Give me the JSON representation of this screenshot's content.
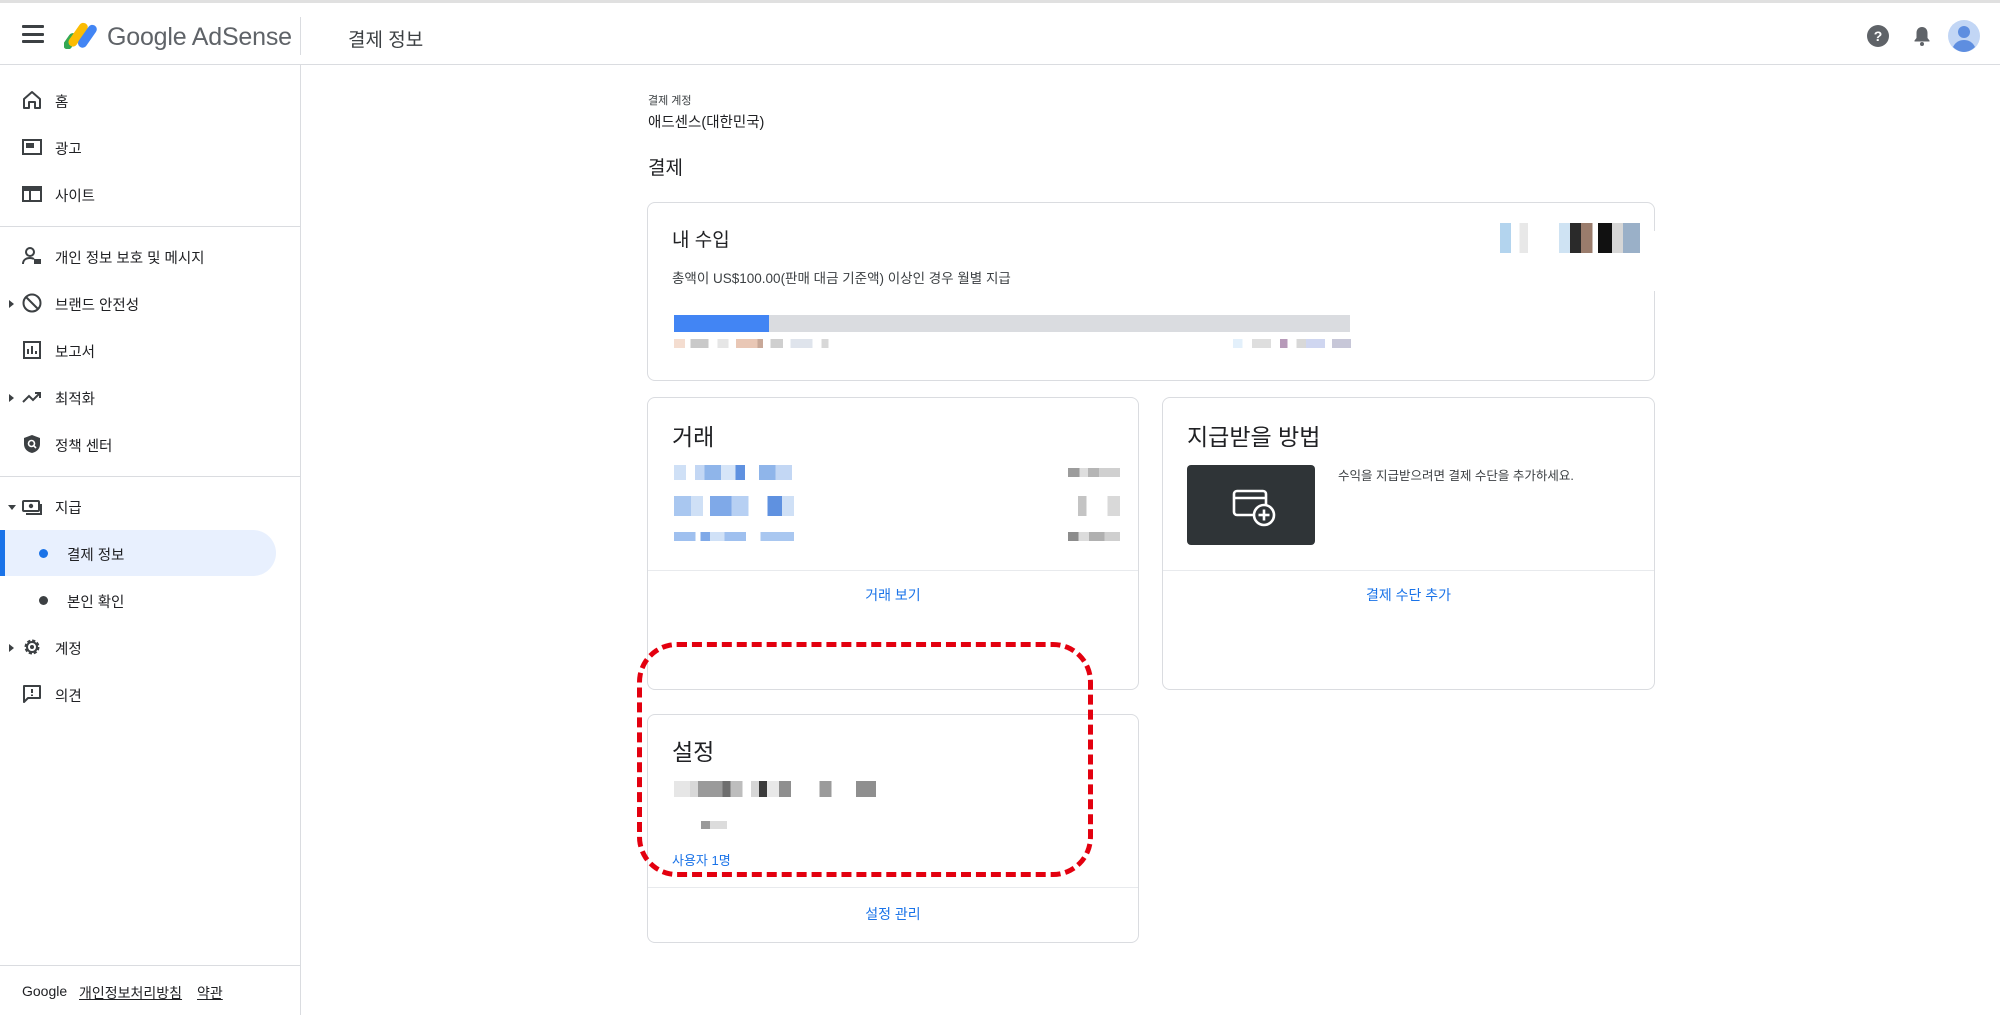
{
  "app": {
    "brand": "Google AdSense",
    "page_title": "결제 정보"
  },
  "colors": {
    "accent": "#1a73e8",
    "progress": "#4285f4",
    "highlight": "#e3000f",
    "active_bg": "#e8f0fe"
  },
  "header_icons": [
    "help-icon",
    "notifications-bell-icon",
    "account-avatar-icon"
  ],
  "sidebar": {
    "items": [
      {
        "label": "홈",
        "icon": "home-icon"
      },
      {
        "label": "광고",
        "icon": "ads-icon"
      },
      {
        "label": "사이트",
        "icon": "sites-icon"
      },
      {
        "label": "개인 정보 보호 및 메시지",
        "icon": "privacy-messaging-icon"
      },
      {
        "label": "브랜드 안전성",
        "icon": "block-icon"
      },
      {
        "label": "보고서",
        "icon": "reports-icon"
      },
      {
        "label": "최적화",
        "icon": "trending-up-icon"
      },
      {
        "label": "정책 센터",
        "icon": "policy-shield-icon"
      },
      {
        "label": "지급",
        "icon": "payments-icon"
      },
      {
        "label": "결제 정보",
        "icon": "dot"
      },
      {
        "label": "본인 확인",
        "icon": "dot"
      },
      {
        "label": "계정",
        "icon": "gear-icon"
      },
      {
        "label": "의견",
        "icon": "feedback-icon"
      }
    ],
    "active": "결제 정보",
    "footer": {
      "google": "Google",
      "privacy": "개인정보처리방침",
      "terms": "약관"
    }
  },
  "main": {
    "account_label": "결제 계정",
    "account_value": "애드센스(대한민국)",
    "section_title": "결제",
    "earnings": {
      "title": "내 수입",
      "description": "총액이 US$100.00(판매 대금 기준액) 이상인 경우 월별 지급",
      "progress_fraction": 0.14
    },
    "transactions": {
      "title": "거래",
      "link": "거래 보기"
    },
    "payment_method": {
      "title": "지급받을 방법",
      "description": "수익을 지급받으려면 결제 수단을 추가하세요.",
      "link": "결제 수단 추가",
      "icon": "add-card-icon"
    },
    "settings": {
      "title": "설정",
      "users": "사용자 1명",
      "link": "설정 관리"
    }
  }
}
